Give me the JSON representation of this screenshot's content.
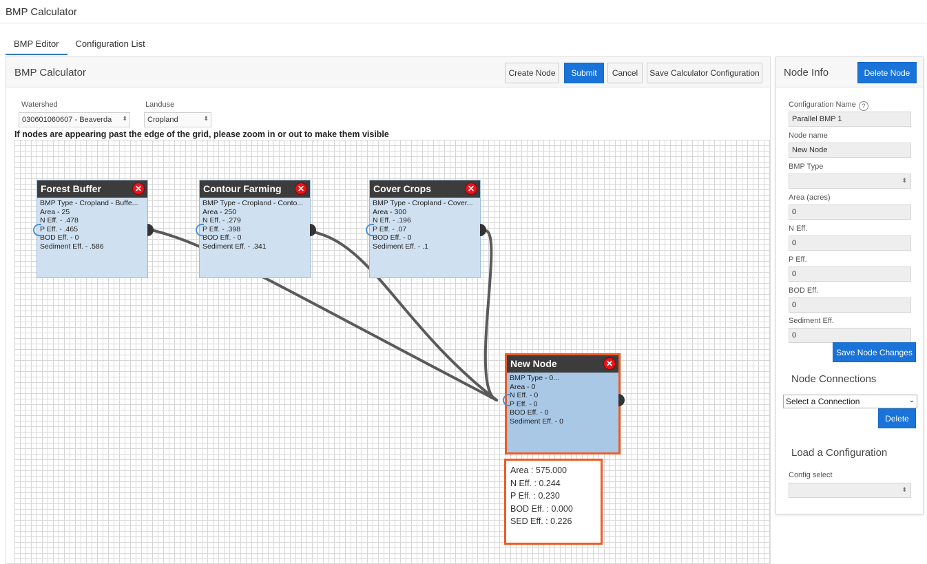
{
  "app": {
    "title": "BMP Calculator"
  },
  "tabs": [
    {
      "label": "BMP Editor",
      "active": true
    },
    {
      "label": "Configuration List",
      "active": false
    }
  ],
  "main": {
    "title": "BMP Calculator",
    "toolbar": {
      "create_node": "Create Node",
      "submit": "Submit",
      "cancel": "Cancel",
      "save_config": "Save Calculator Configuration"
    },
    "watershed": {
      "label": "Watershed",
      "value": "030601060607 - Beaverda"
    },
    "landuse": {
      "label": "Landuse",
      "value": "Cropland"
    },
    "warning": "If nodes are appearing past the edge of the grid, please zoom in or out to make them visible"
  },
  "nodes": [
    {
      "title": "Forest Buffer",
      "lines": [
        "BMP Type - Cropland - Buffe...",
        "Area - 25",
        "N Eff. - .478",
        "P Eff. - .465",
        "BOD Eff. - 0",
        "Sediment Eff. - .586"
      ]
    },
    {
      "title": "Contour Farming",
      "lines": [
        "BMP Type - Cropland - Conto...",
        "Area - 250",
        "N Eff. - .279",
        "P Eff. - .398",
        "BOD Eff. - 0",
        "Sediment Eff. - .341"
      ]
    },
    {
      "title": "Cover Crops",
      "lines": [
        "BMP Type - Cropland - Cover...",
        "Area - 300",
        "N Eff. - .196",
        "P Eff. - .07",
        "BOD Eff. - 0",
        "Sediment Eff. - .1"
      ]
    },
    {
      "title": "New Node",
      "lines": [
        "BMP Type - 0...",
        "Area - 0",
        "N Eff. - 0",
        "P Eff. - 0",
        "BOD Eff. - 0",
        "Sediment Eff. - 0"
      ]
    }
  ],
  "result": {
    "lines": [
      "Area : 575.000",
      "N Eff. : 0.244",
      "P Eff. : 0.230",
      "BOD Eff. : 0.000",
      "SED Eff. : 0.226"
    ]
  },
  "node_info": {
    "title": "Node Info",
    "delete_node": "Delete Node",
    "config_name_label": "Configuration Name",
    "config_name_value": "Parallel BMP 1",
    "node_name_label": "Node name",
    "node_name_value": "New Node",
    "bmp_type_label": "BMP Type",
    "bmp_type_value": "",
    "area_label": "Area (acres)",
    "area_value": "0",
    "n_eff_label": "N Eff.",
    "n_eff_value": "0",
    "p_eff_label": "P Eff.",
    "p_eff_value": "0",
    "bod_eff_label": "BOD Eff.",
    "bod_eff_value": "0",
    "sed_eff_label": "Sediment Eff.",
    "sed_eff_value": "0",
    "save_changes": "Save Node Changes",
    "connections_title": "Node Connections",
    "connection_select": "Select a Connection",
    "delete_connection": "Delete",
    "load_title": "Load a Configuration",
    "config_select_label": "Config select",
    "config_select_value": ""
  },
  "icons": {
    "close": "close-icon",
    "help": "help-icon",
    "dropdown": "chevron-down-icon"
  },
  "colors": {
    "accent": "#1a73d9",
    "selected_border": "#f15a22",
    "node_bg": "#cfe0f0",
    "node_header": "#3c3c3c",
    "close_red": "#e8141b"
  }
}
